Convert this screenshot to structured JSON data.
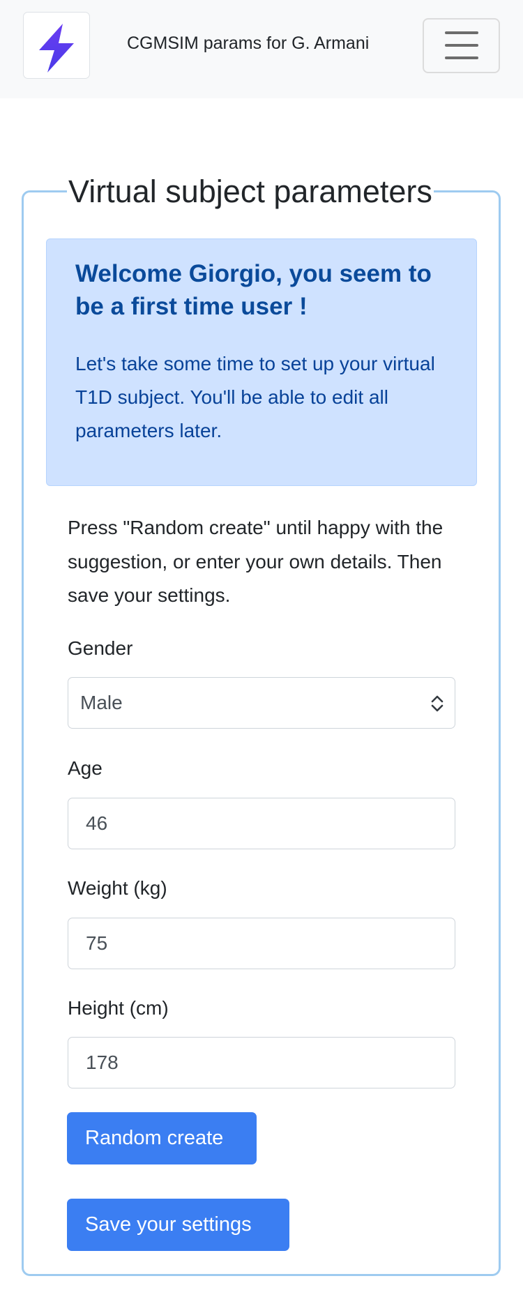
{
  "navbar": {
    "logo_icon": "lightning-bolt-icon",
    "brand_color": "#5b3cf0",
    "title": "CGMSIM params for G. Armani",
    "menu_icon": "hamburger-menu-icon"
  },
  "form": {
    "legend": "Virtual subject parameters",
    "alert": {
      "heading": "Welcome Giorgio, you seem to be a first time user !",
      "body": "Let's take some time to set up your virtual T1D subject. You'll be able to edit all parameters later."
    },
    "intro": "Press \"Random create\" until happy with the suggestion, or enter your own details. Then save your settings.",
    "gender": {
      "label": "Gender",
      "value": "Male"
    },
    "age": {
      "label": "Age",
      "value": "46"
    },
    "weight": {
      "label": "Weight (kg)",
      "value": "75"
    },
    "height": {
      "label": "Height (cm)",
      "value": "178"
    },
    "random_button": "Random create",
    "save_button": "Save your settings",
    "accent_color": "#3b7ef2"
  }
}
